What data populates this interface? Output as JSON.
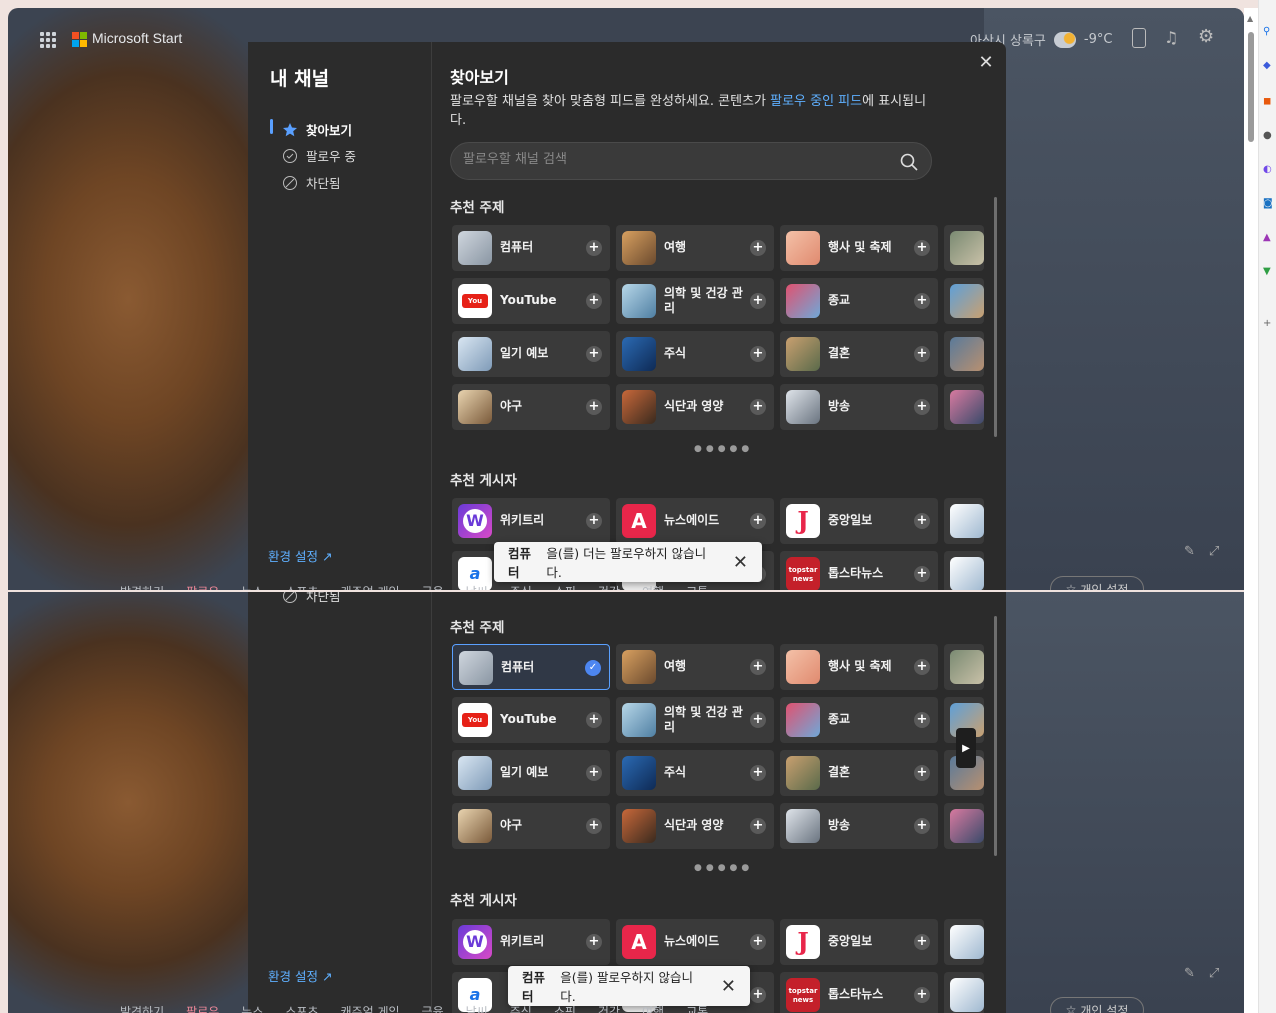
{
  "header": {
    "brand": "Microsoft Start",
    "weather": {
      "location": "아산시 상록구",
      "temp": "-9°C"
    },
    "topic_left": "",
    "topic_right": ""
  },
  "dialog": {
    "sidebar": {
      "title": "내 채널",
      "nav": [
        {
          "label": "찾아보기",
          "icon": "discover-icon",
          "active": true
        },
        {
          "label": "팔로우 중",
          "icon": "check-circle-icon",
          "active": false
        },
        {
          "label": "차단됨",
          "icon": "block-icon",
          "active": false
        }
      ],
      "settings_link": "환경 설정"
    },
    "title": "찾아보기",
    "description": "팔로우할 채널을 찾아 맞춤형 피드를 완성하세요. 콘텐츠가 ",
    "description_link": "팔로우 중인 피드",
    "description_tail": "에 표시됩니다.",
    "search_placeholder": "팔로우할 채널 검색",
    "section_topics": "추천 주제",
    "section_publishers": "추천 게시자",
    "topics": [
      [
        "컴퓨터",
        "여행",
        "행사 및 축제"
      ],
      [
        "YouTube",
        "의학 및 건강 관리",
        "종교"
      ],
      [
        "일기 예보",
        "주식",
        "결혼"
      ],
      [
        "야구",
        "식단과 영양",
        "방송"
      ]
    ],
    "publishers": [
      [
        "위키트리",
        "뉴스에이드",
        "중앙일보"
      ],
      [
        "",
        "",
        "톱스타뉴스"
      ]
    ],
    "publisher_thumb_text": {
      "topstar": "topstar news",
      "joongang": "J"
    }
  },
  "toast_top": {
    "bold": "컴퓨터",
    "text": "을(를) 더는 팔로우하지 않습니다."
  },
  "toast_bottom": {
    "bold": "컴퓨터",
    "text": "을(를) 팔로우하지 않습니다."
  },
  "bottom_nav": [
    "발견하기",
    "팔로우",
    "뉴스",
    "스포츠",
    "캐주얼 게임",
    "금융",
    "날씨",
    "주식",
    "쇼핑",
    "건강",
    "여행",
    "교통"
  ],
  "personalize_button": "개인 설정",
  "colors": {
    "accent": "#5aa0ff",
    "selected": "#4d86f0",
    "active_tab": "#ee8899"
  }
}
